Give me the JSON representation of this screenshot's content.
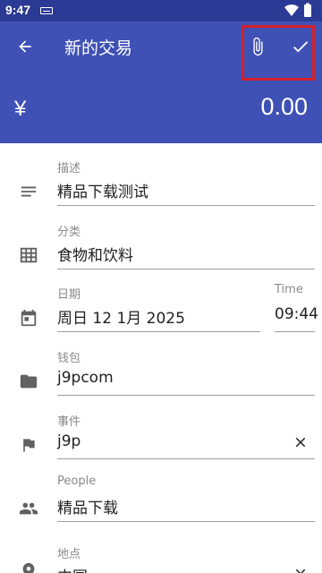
{
  "status_bar": {
    "time": "9:47"
  },
  "app_bar": {
    "title": "新的交易",
    "back_icon": "arrow-back-icon",
    "attach_icon": "paperclip-icon",
    "confirm_icon": "check-icon"
  },
  "amount": {
    "currency": "¥",
    "value": "0.00"
  },
  "fields": {
    "description": {
      "label": "描述",
      "value": "精品下载测试"
    },
    "category": {
      "label": "分类",
      "value": "食物和饮料"
    },
    "date": {
      "label": "日期",
      "value": "周日 12 1月 2025"
    },
    "time": {
      "label": "Time",
      "value": "09:44"
    },
    "wallet": {
      "label": "钱包",
      "value": "j9pcom"
    },
    "event": {
      "label": "事件",
      "value": "j9p"
    },
    "people": {
      "label": "People",
      "value": "精品下载"
    },
    "location": {
      "label": "地点",
      "value": "中国"
    }
  },
  "colors": {
    "primary": "#3f51b5",
    "primary_dark": "#2b3a94",
    "highlight": "#d6212a",
    "icon_grey": "#616161"
  }
}
